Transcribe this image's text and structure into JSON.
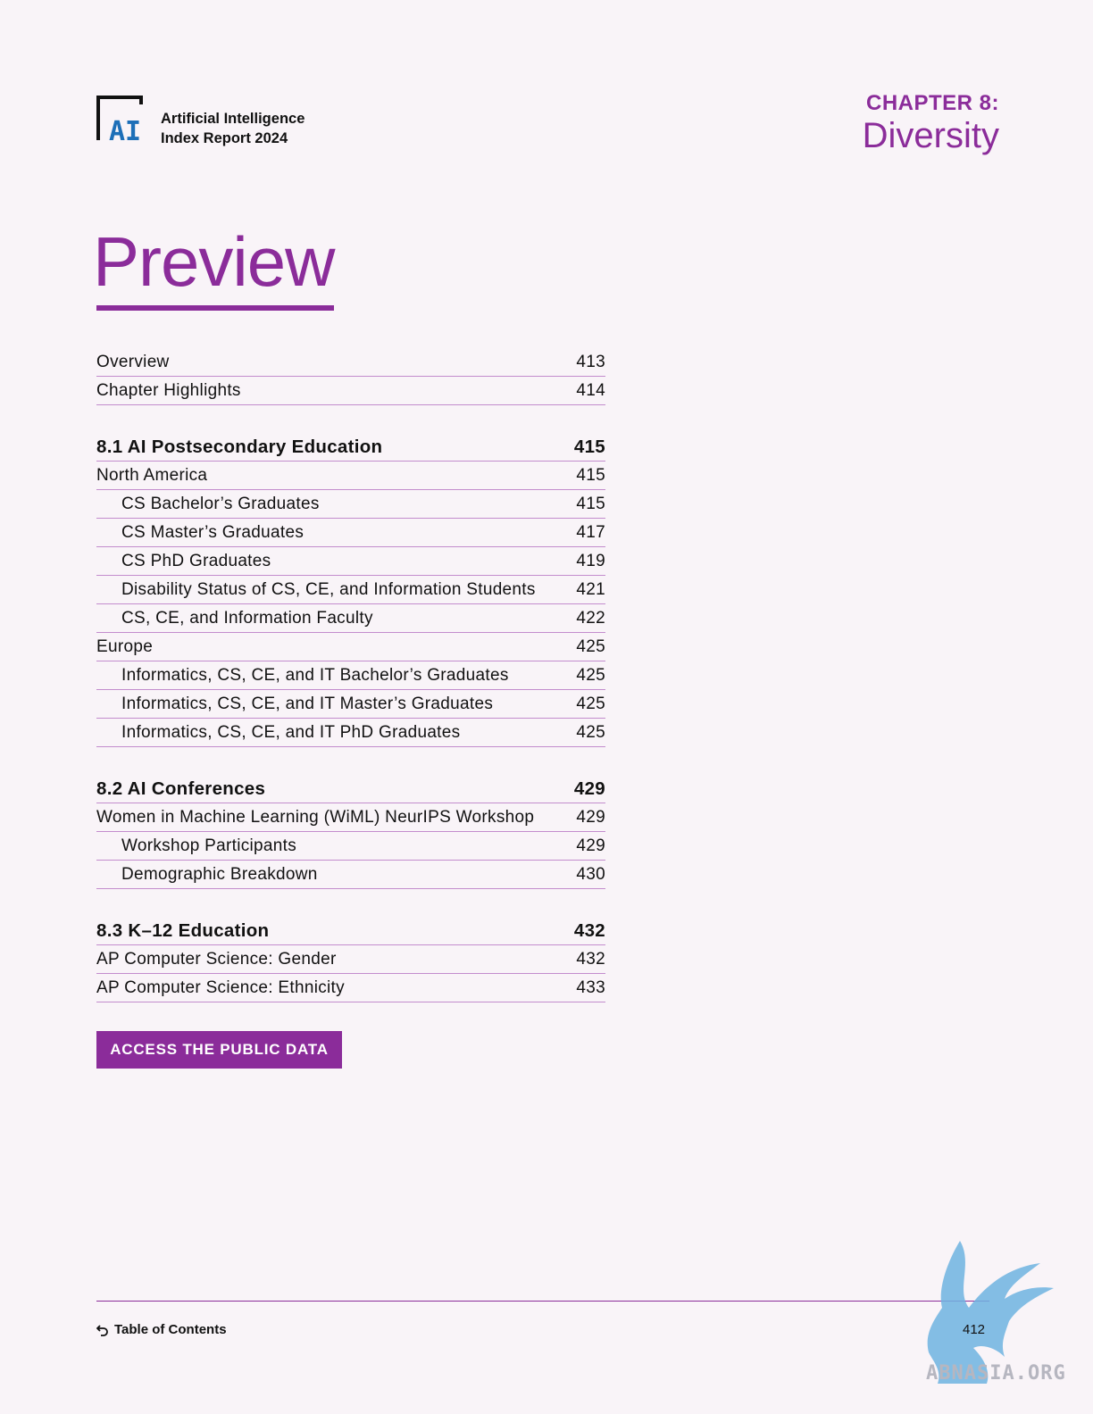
{
  "header": {
    "logo_text": "AI",
    "report_line1": "Artificial Intelligence",
    "report_line2": "Index Report 2024",
    "chapter_label": "CHAPTER 8:",
    "chapter_name": "Diversity"
  },
  "title": "Preview",
  "toc": [
    {
      "label": "Overview",
      "page": "413",
      "type": "item"
    },
    {
      "label": "Chapter Highlights",
      "page": "414",
      "type": "item"
    },
    {
      "type": "gap"
    },
    {
      "label": "8.1 AI Postsecondary Education",
      "page": "415",
      "type": "section"
    },
    {
      "label": "North America",
      "page": "415",
      "type": "item"
    },
    {
      "label": "CS Bachelor’s Graduates",
      "page": "415",
      "type": "indent"
    },
    {
      "label": "CS Master’s Graduates",
      "page": "417",
      "type": "indent"
    },
    {
      "label": "CS PhD Graduates",
      "page": "419",
      "type": "indent"
    },
    {
      "label": "Disability Status of CS, CE, and Information Students",
      "page": "421",
      "type": "indent"
    },
    {
      "label": "CS, CE, and Information Faculty",
      "page": "422",
      "type": "indent"
    },
    {
      "label": "Europe",
      "page": "425",
      "type": "item"
    },
    {
      "label": "Informatics, CS, CE, and IT Bachelor’s Graduates",
      "page": "425",
      "type": "indent"
    },
    {
      "label": "Informatics, CS, CE, and IT Master’s Graduates",
      "page": "425",
      "type": "indent"
    },
    {
      "label": "Informatics, CS, CE, and IT PhD Graduates",
      "page": "425",
      "type": "indent"
    },
    {
      "type": "gap"
    },
    {
      "label": "8.2 AI Conferences",
      "page": "429",
      "type": "section"
    },
    {
      "label": "Women in Machine Learning (WiML) NeurIPS Workshop",
      "page": "429",
      "type": "item"
    },
    {
      "label": "Workshop Participants",
      "page": "429",
      "type": "indent"
    },
    {
      "label": "Demographic Breakdown",
      "page": "430",
      "type": "indent"
    },
    {
      "type": "gap"
    },
    {
      "label": "8.3 K–12 Education",
      "page": "432",
      "type": "section"
    },
    {
      "label": "AP Computer Science: Gender",
      "page": "432",
      "type": "item"
    },
    {
      "label": "AP Computer Science: Ethnicity",
      "page": "433",
      "type": "item"
    }
  ],
  "cta_label": "ACCESS THE PUBLIC DATA",
  "footer": {
    "toc_link": "Table of Contents",
    "page_number": "412",
    "watermark_text": "ABNASIA.ORG"
  },
  "colors": {
    "accent": "#8b2c9a",
    "background": "#f9f4f8",
    "logo_blue": "#1d6fb8",
    "watermark": "#6fb3e0"
  }
}
